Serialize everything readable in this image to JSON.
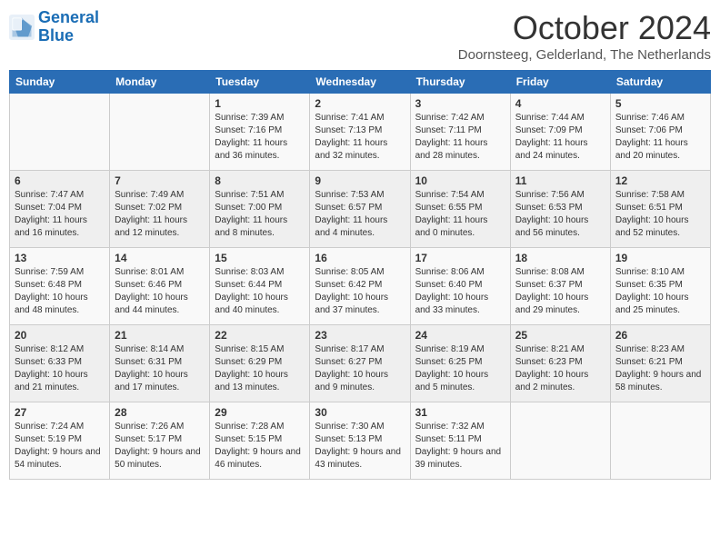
{
  "logo": {
    "line1": "General",
    "line2": "Blue"
  },
  "title": "October 2024",
  "location": "Doornsteeg, Gelderland, The Netherlands",
  "days_of_week": [
    "Sunday",
    "Monday",
    "Tuesday",
    "Wednesday",
    "Thursday",
    "Friday",
    "Saturday"
  ],
  "weeks": [
    [
      {
        "day": "",
        "sunrise": "",
        "sunset": "",
        "daylight": ""
      },
      {
        "day": "",
        "sunrise": "",
        "sunset": "",
        "daylight": ""
      },
      {
        "day": "1",
        "sunrise": "Sunrise: 7:39 AM",
        "sunset": "Sunset: 7:16 PM",
        "daylight": "Daylight: 11 hours and 36 minutes."
      },
      {
        "day": "2",
        "sunrise": "Sunrise: 7:41 AM",
        "sunset": "Sunset: 7:13 PM",
        "daylight": "Daylight: 11 hours and 32 minutes."
      },
      {
        "day": "3",
        "sunrise": "Sunrise: 7:42 AM",
        "sunset": "Sunset: 7:11 PM",
        "daylight": "Daylight: 11 hours and 28 minutes."
      },
      {
        "day": "4",
        "sunrise": "Sunrise: 7:44 AM",
        "sunset": "Sunset: 7:09 PM",
        "daylight": "Daylight: 11 hours and 24 minutes."
      },
      {
        "day": "5",
        "sunrise": "Sunrise: 7:46 AM",
        "sunset": "Sunset: 7:06 PM",
        "daylight": "Daylight: 11 hours and 20 minutes."
      }
    ],
    [
      {
        "day": "6",
        "sunrise": "Sunrise: 7:47 AM",
        "sunset": "Sunset: 7:04 PM",
        "daylight": "Daylight: 11 hours and 16 minutes."
      },
      {
        "day": "7",
        "sunrise": "Sunrise: 7:49 AM",
        "sunset": "Sunset: 7:02 PM",
        "daylight": "Daylight: 11 hours and 12 minutes."
      },
      {
        "day": "8",
        "sunrise": "Sunrise: 7:51 AM",
        "sunset": "Sunset: 7:00 PM",
        "daylight": "Daylight: 11 hours and 8 minutes."
      },
      {
        "day": "9",
        "sunrise": "Sunrise: 7:53 AM",
        "sunset": "Sunset: 6:57 PM",
        "daylight": "Daylight: 11 hours and 4 minutes."
      },
      {
        "day": "10",
        "sunrise": "Sunrise: 7:54 AM",
        "sunset": "Sunset: 6:55 PM",
        "daylight": "Daylight: 11 hours and 0 minutes."
      },
      {
        "day": "11",
        "sunrise": "Sunrise: 7:56 AM",
        "sunset": "Sunset: 6:53 PM",
        "daylight": "Daylight: 10 hours and 56 minutes."
      },
      {
        "day": "12",
        "sunrise": "Sunrise: 7:58 AM",
        "sunset": "Sunset: 6:51 PM",
        "daylight": "Daylight: 10 hours and 52 minutes."
      }
    ],
    [
      {
        "day": "13",
        "sunrise": "Sunrise: 7:59 AM",
        "sunset": "Sunset: 6:48 PM",
        "daylight": "Daylight: 10 hours and 48 minutes."
      },
      {
        "day": "14",
        "sunrise": "Sunrise: 8:01 AM",
        "sunset": "Sunset: 6:46 PM",
        "daylight": "Daylight: 10 hours and 44 minutes."
      },
      {
        "day": "15",
        "sunrise": "Sunrise: 8:03 AM",
        "sunset": "Sunset: 6:44 PM",
        "daylight": "Daylight: 10 hours and 40 minutes."
      },
      {
        "day": "16",
        "sunrise": "Sunrise: 8:05 AM",
        "sunset": "Sunset: 6:42 PM",
        "daylight": "Daylight: 10 hours and 37 minutes."
      },
      {
        "day": "17",
        "sunrise": "Sunrise: 8:06 AM",
        "sunset": "Sunset: 6:40 PM",
        "daylight": "Daylight: 10 hours and 33 minutes."
      },
      {
        "day": "18",
        "sunrise": "Sunrise: 8:08 AM",
        "sunset": "Sunset: 6:37 PM",
        "daylight": "Daylight: 10 hours and 29 minutes."
      },
      {
        "day": "19",
        "sunrise": "Sunrise: 8:10 AM",
        "sunset": "Sunset: 6:35 PM",
        "daylight": "Daylight: 10 hours and 25 minutes."
      }
    ],
    [
      {
        "day": "20",
        "sunrise": "Sunrise: 8:12 AM",
        "sunset": "Sunset: 6:33 PM",
        "daylight": "Daylight: 10 hours and 21 minutes."
      },
      {
        "day": "21",
        "sunrise": "Sunrise: 8:14 AM",
        "sunset": "Sunset: 6:31 PM",
        "daylight": "Daylight: 10 hours and 17 minutes."
      },
      {
        "day": "22",
        "sunrise": "Sunrise: 8:15 AM",
        "sunset": "Sunset: 6:29 PM",
        "daylight": "Daylight: 10 hours and 13 minutes."
      },
      {
        "day": "23",
        "sunrise": "Sunrise: 8:17 AM",
        "sunset": "Sunset: 6:27 PM",
        "daylight": "Daylight: 10 hours and 9 minutes."
      },
      {
        "day": "24",
        "sunrise": "Sunrise: 8:19 AM",
        "sunset": "Sunset: 6:25 PM",
        "daylight": "Daylight: 10 hours and 5 minutes."
      },
      {
        "day": "25",
        "sunrise": "Sunrise: 8:21 AM",
        "sunset": "Sunset: 6:23 PM",
        "daylight": "Daylight: 10 hours and 2 minutes."
      },
      {
        "day": "26",
        "sunrise": "Sunrise: 8:23 AM",
        "sunset": "Sunset: 6:21 PM",
        "daylight": "Daylight: 9 hours and 58 minutes."
      }
    ],
    [
      {
        "day": "27",
        "sunrise": "Sunrise: 7:24 AM",
        "sunset": "Sunset: 5:19 PM",
        "daylight": "Daylight: 9 hours and 54 minutes."
      },
      {
        "day": "28",
        "sunrise": "Sunrise: 7:26 AM",
        "sunset": "Sunset: 5:17 PM",
        "daylight": "Daylight: 9 hours and 50 minutes."
      },
      {
        "day": "29",
        "sunrise": "Sunrise: 7:28 AM",
        "sunset": "Sunset: 5:15 PM",
        "daylight": "Daylight: 9 hours and 46 minutes."
      },
      {
        "day": "30",
        "sunrise": "Sunrise: 7:30 AM",
        "sunset": "Sunset: 5:13 PM",
        "daylight": "Daylight: 9 hours and 43 minutes."
      },
      {
        "day": "31",
        "sunrise": "Sunrise: 7:32 AM",
        "sunset": "Sunset: 5:11 PM",
        "daylight": "Daylight: 9 hours and 39 minutes."
      },
      {
        "day": "",
        "sunrise": "",
        "sunset": "",
        "daylight": ""
      },
      {
        "day": "",
        "sunrise": "",
        "sunset": "",
        "daylight": ""
      }
    ]
  ]
}
